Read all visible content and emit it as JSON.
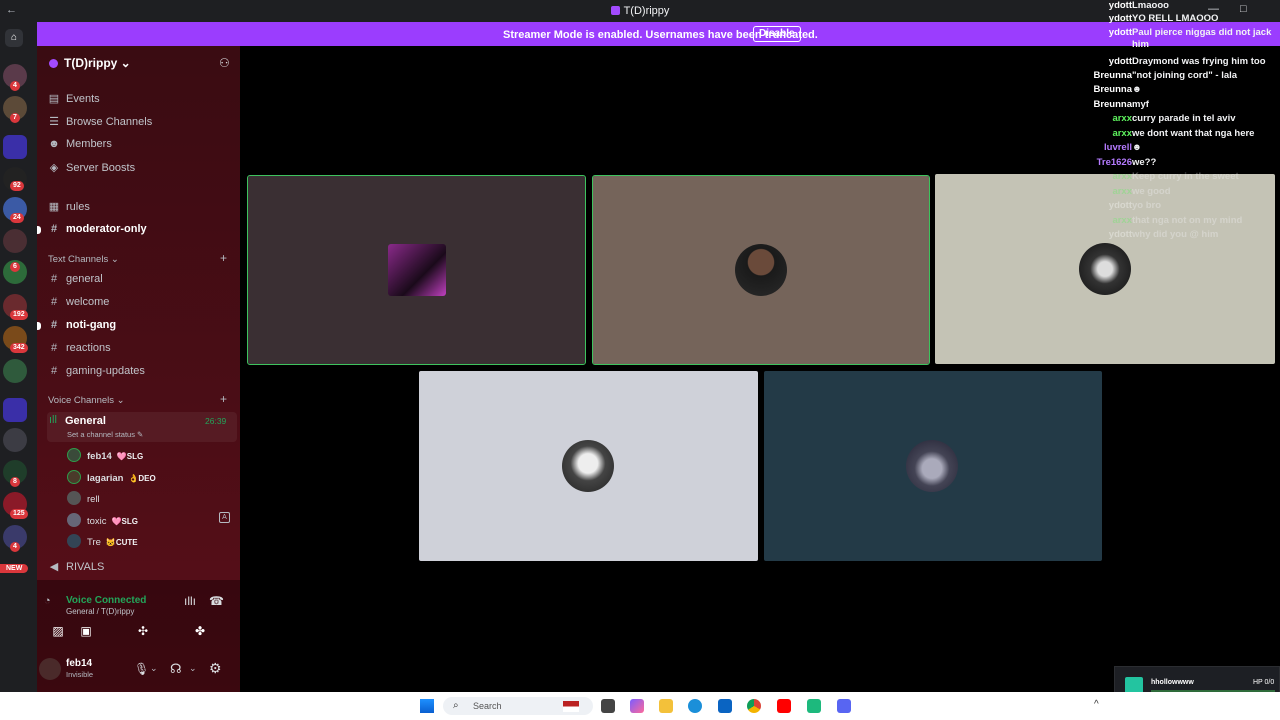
{
  "window": {
    "title": "T(D)rippy",
    "back": "←",
    "controls": [
      "—",
      "□",
      "✕"
    ]
  },
  "banner": {
    "message": "Streamer Mode is enabled. Usernames have been truncated.",
    "disable_label": "Disable"
  },
  "servers": {
    "badges": [
      "4",
      "7",
      "92",
      "24",
      "6",
      "192",
      "342",
      "8",
      "125",
      "4"
    ],
    "new_label": "NEW"
  },
  "guild": {
    "name": "T(D)rippy ⌄"
  },
  "nav": [
    {
      "label": "Events",
      "icon": "calendar-icon"
    },
    {
      "label": "Browse Channels",
      "icon": "list-icon"
    },
    {
      "label": "Members",
      "icon": "members-icon"
    },
    {
      "label": "Server Boosts",
      "icon": "boost-icon"
    }
  ],
  "top_channels": [
    {
      "label": "rules",
      "icon": "rules-icon",
      "bold": false
    },
    {
      "label": "moderator-only",
      "icon": "hash-icon",
      "bold": true
    }
  ],
  "text_category": "Text Channels ⌄",
  "text_channels": [
    {
      "label": "general",
      "bold": false
    },
    {
      "label": "welcome",
      "bold": false
    },
    {
      "label": "noti-gang",
      "bold": true
    },
    {
      "label": "reactions",
      "bold": false
    },
    {
      "label": "gaming-updates",
      "bold": false
    }
  ],
  "voice_category": "Voice Channels ⌄",
  "voice_general": {
    "name": "General",
    "timer": "26:39",
    "status": "Set a channel status ✎"
  },
  "voice_users": [
    {
      "name": "feb14",
      "tag": "🩷SLG"
    },
    {
      "name": "lagarian",
      "tag": "👌DEO"
    },
    {
      "name": "rell",
      "tag": ""
    },
    {
      "name": "toxic",
      "tag": "🩷SLG"
    },
    {
      "name": "Tre",
      "tag": "😺CUTE"
    }
  ],
  "rivals_channel": "RIVALS",
  "voice_panel": {
    "title": "Voice Connected",
    "subtitle": "General / T(D)rippy"
  },
  "user": {
    "name": "feb14",
    "status": "Invisible"
  },
  "chat": [
    {
      "name": "ydott",
      "text": "Lmaooo",
      "color": "#ffffff"
    },
    {
      "name": "ydott",
      "text": "YO RELL LMAOOO",
      "color": "#ffffff"
    },
    {
      "name": "ydott",
      "text": "Paul pierce niggas did not jack him",
      "color": "#ffffff"
    },
    {
      "name": "ydott",
      "text": "Draymond was frying him too",
      "color": "#ffffff"
    },
    {
      "name": "Breunna",
      "text": "\"not joining cord\" - lala",
      "color": "#ffffff"
    },
    {
      "name": "Breunna",
      "text": "☻",
      "color": "#ffffff"
    },
    {
      "name": "Breunna",
      "text": "myf",
      "color": "#ffffff"
    },
    {
      "name": "arxx",
      "text": "curry parade in tel aviv",
      "color": "#5ef25e"
    },
    {
      "name": "arxx",
      "text": "we dont want that nga here",
      "color": "#5ef25e"
    },
    {
      "name": "luvrell",
      "text": "☻",
      "color": "#b57bff"
    },
    {
      "name": "Tre1626",
      "text": "we??",
      "color": "#b57bff"
    },
    {
      "name": "arxx",
      "text": "Keep curry in the sweet",
      "color": "#5ef25e"
    },
    {
      "name": "arxx",
      "text": "we good",
      "color": "#5ef25e"
    },
    {
      "name": "ydott",
      "text": "yo bro",
      "color": "#ffffff"
    },
    {
      "name": "arxx",
      "text": "that nga not on my mind",
      "color": "#5ef25e"
    },
    {
      "name": "ydott",
      "text": "why did you @ him",
      "color": "#ffffff"
    }
  ],
  "taskbar": {
    "search_placeholder": "Search"
  },
  "hp_widget": {
    "name": "hhollowwww",
    "hp": "HP 0/0"
  }
}
